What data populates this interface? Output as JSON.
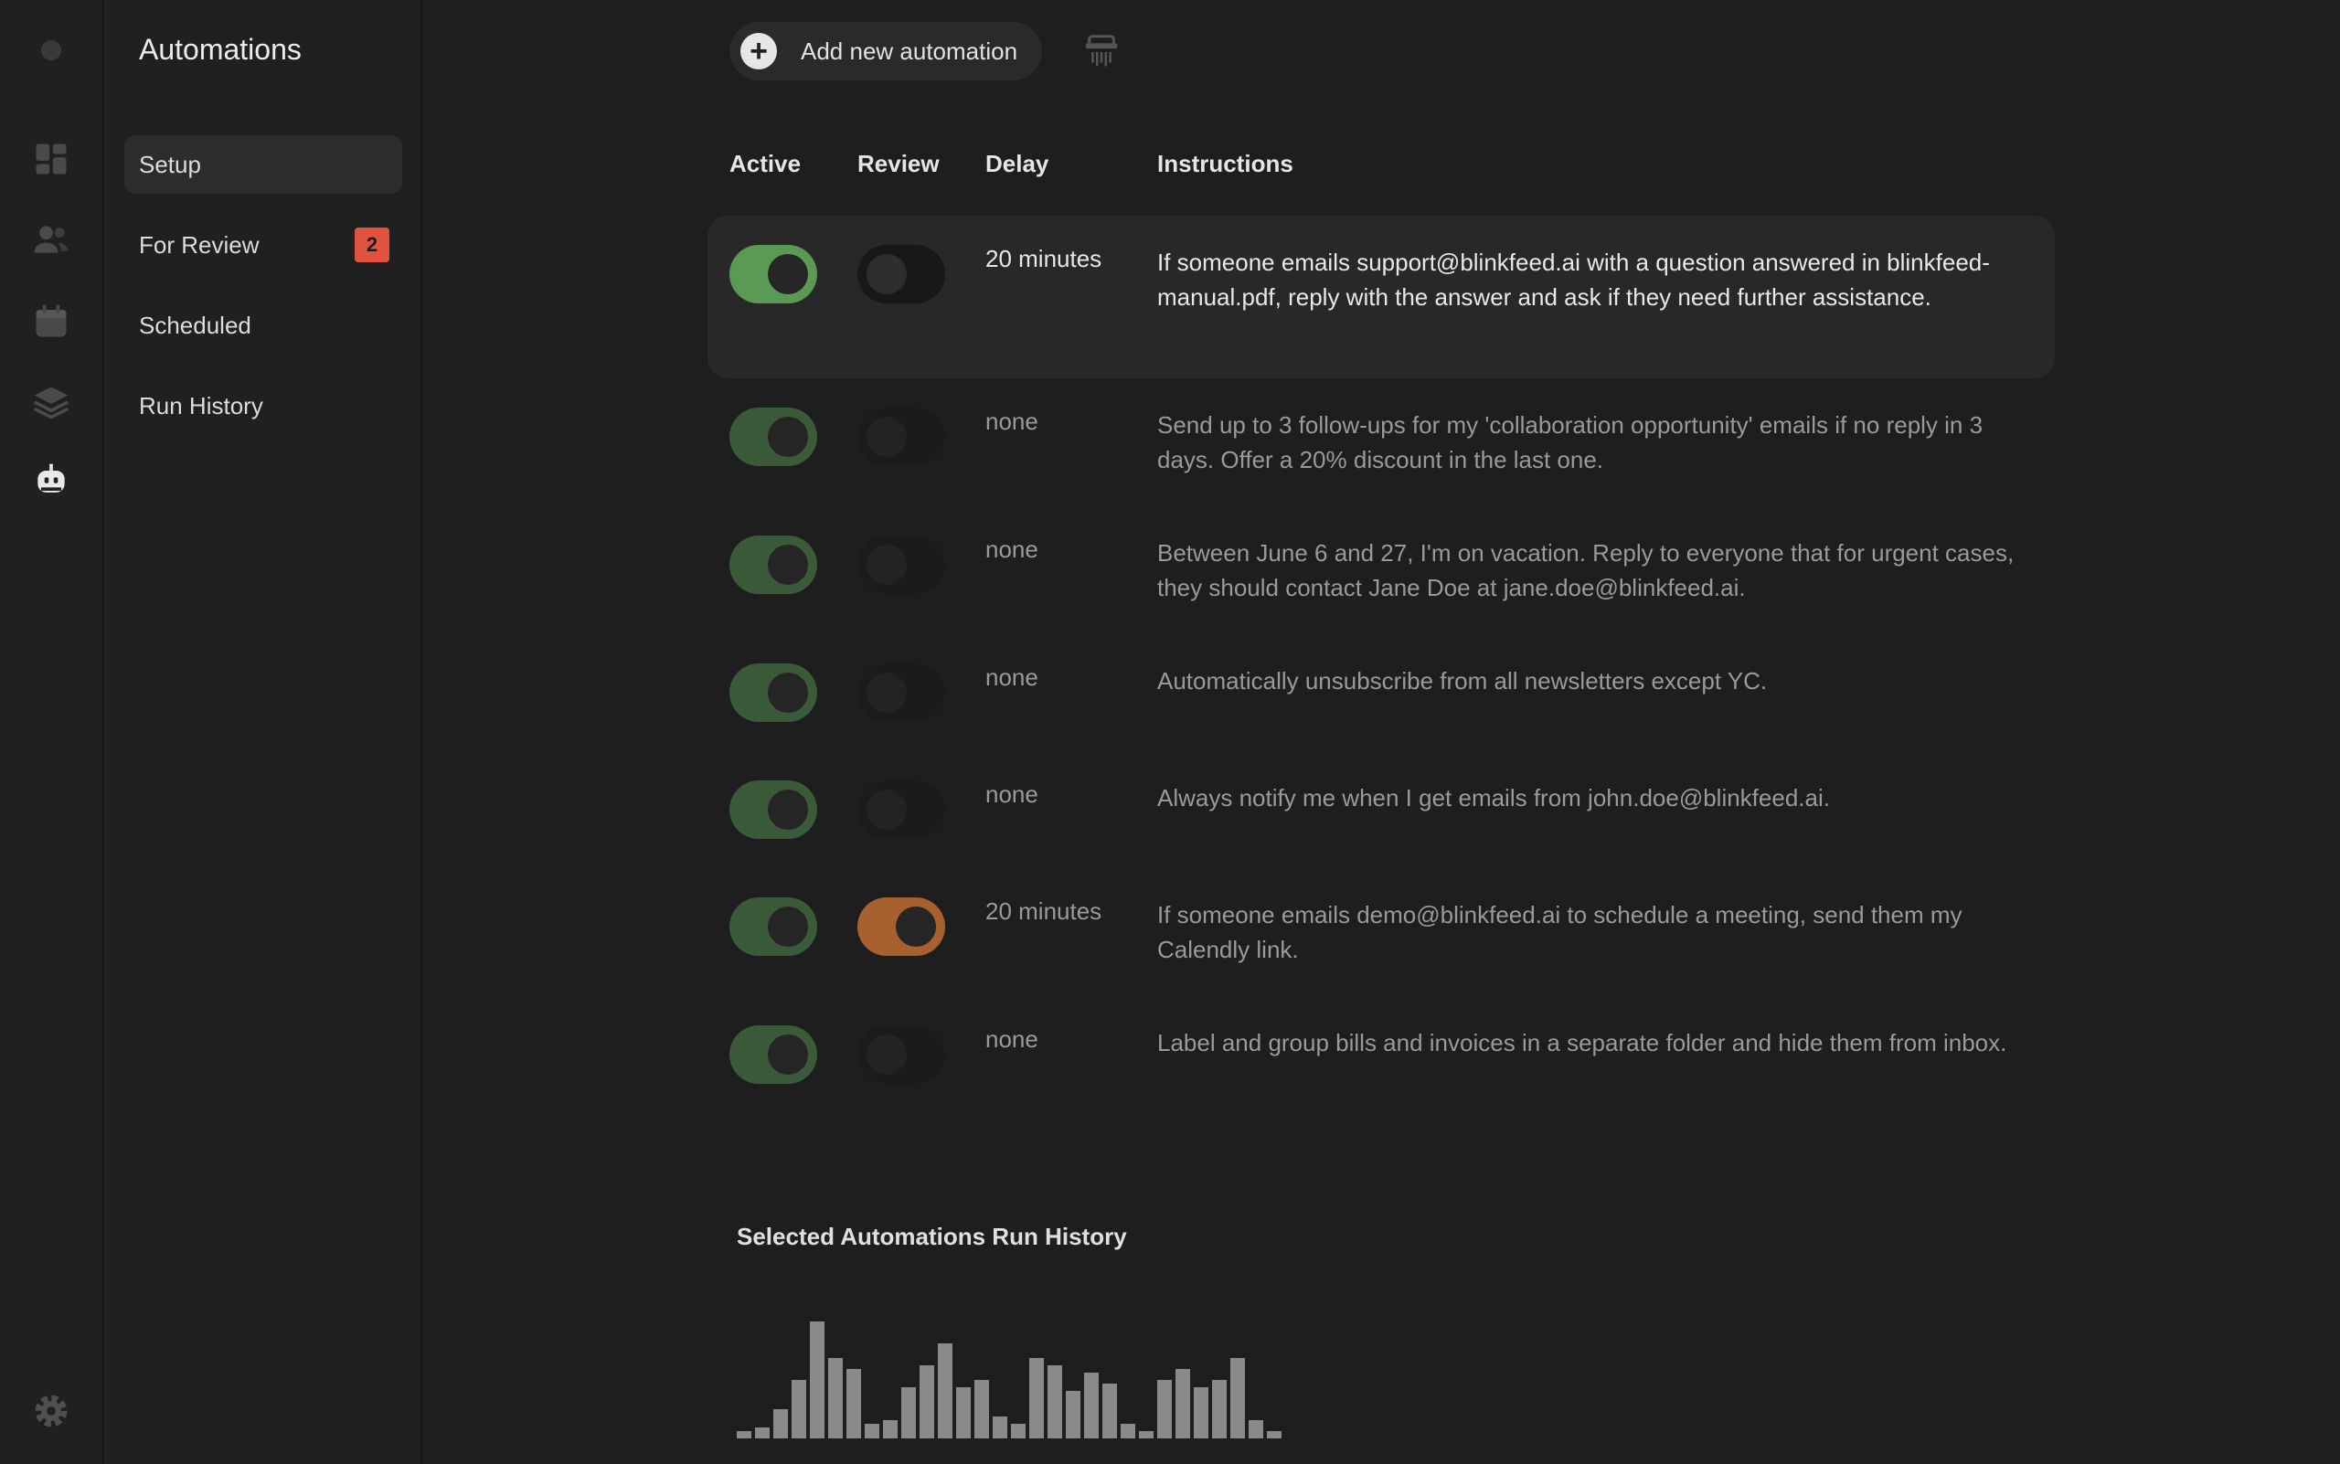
{
  "rail": {
    "icons": [
      "dashboard-icon",
      "contacts-icon",
      "calendar-icon",
      "layers-icon",
      "robot-icon",
      "settings-icon"
    ]
  },
  "sidenav": {
    "title": "Automations",
    "items": [
      {
        "label": "Setup",
        "active": true
      },
      {
        "label": "For Review",
        "badge": "2"
      },
      {
        "label": "Scheduled"
      },
      {
        "label": "Run History"
      }
    ]
  },
  "toolbar": {
    "add_label": "Add new automation"
  },
  "table": {
    "headers": {
      "active": "Active",
      "review": "Review",
      "delay": "Delay",
      "instructions": "Instructions"
    },
    "rows": [
      {
        "active": true,
        "review": false,
        "delay": "20 minutes",
        "instructions": "If someone emails support@blinkfeed.ai with a question answered in blinkfeed-manual.pdf, reply with the answer and ask if they need further assistance.",
        "selected": true
      },
      {
        "active": true,
        "review": false,
        "delay": "none",
        "instructions": "Send up to 3 follow-ups for my 'collaboration opportunity' emails if no reply in 3 days. Offer a 20% discount in the last one."
      },
      {
        "active": true,
        "review": false,
        "delay": "none",
        "instructions": "Between June 6 and 27, I'm on vacation. Reply to everyone that for urgent cases, they should contact Jane Doe at jane.doe@blinkfeed.ai."
      },
      {
        "active": true,
        "review": false,
        "delay": "none",
        "instructions": "Automatically unsubscribe from all newsletters except YC."
      },
      {
        "active": true,
        "review": false,
        "delay": "none",
        "instructions": "Always notify me when I get emails from john.doe@blinkfeed.ai."
      },
      {
        "active": true,
        "review": true,
        "delay": "20 minutes",
        "instructions": "If someone emails demo@blinkfeed.ai to schedule a meeting, send them my Calendly link."
      },
      {
        "active": true,
        "review": false,
        "delay": "none",
        "instructions": "Label and group bills and invoices in a separate folder and hide them from inbox."
      }
    ]
  },
  "history": {
    "title": "Selected Automations Run History"
  },
  "chart_data": {
    "type": "bar",
    "values": [
      1,
      1.5,
      4,
      8,
      16,
      11,
      9.5,
      2,
      2.5,
      7,
      10,
      13,
      7,
      8,
      3,
      2,
      11,
      10,
      6.5,
      9,
      7.5,
      2,
      1,
      8,
      9.5,
      7,
      8,
      11,
      2.5,
      1
    ],
    "color": "#8a8a8a"
  },
  "colors": {
    "active_on": "#5a9a55",
    "review_on": "#a8602e",
    "badge": "#e2533f"
  }
}
